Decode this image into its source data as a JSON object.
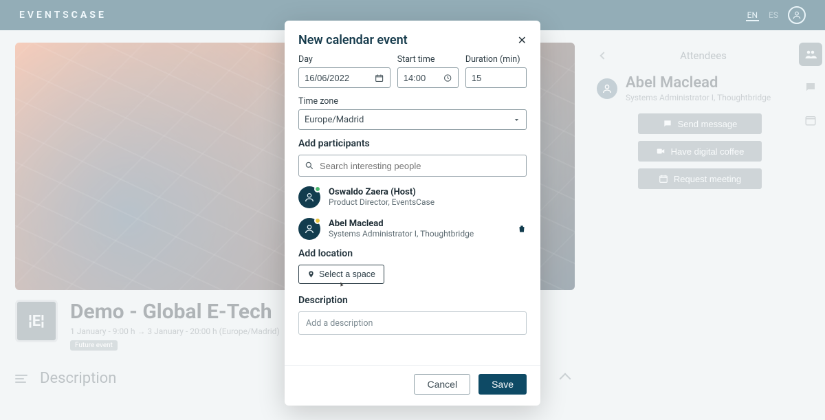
{
  "header": {
    "brand_prefix": "EVENTS",
    "brand_suffix": "CASE",
    "lang_en": "EN",
    "lang_es": "ES"
  },
  "event": {
    "title": "Demo - Global E-Tech",
    "schedule": "1 January - 9:00 h → 3 January - 20:00 h (Europe/Madrid)",
    "badge": "Future event",
    "thumb": "¦E¦",
    "section_title": "Description"
  },
  "sidebar": {
    "header": "Attendees",
    "name": "Abel Maclead",
    "role": "Systems Administrator I, Thoughtbridge",
    "actions": {
      "send_message": "Send message",
      "digital_coffee": "Have digital coffee",
      "request_meeting": "Request meeting"
    }
  },
  "modal": {
    "title": "New calendar event",
    "day_label": "Day",
    "day_value": "16/06/2022",
    "start_label": "Start time",
    "start_value": "14:00",
    "duration_label": "Duration (min)",
    "duration_value": "15",
    "tz_label": "Time zone",
    "tz_value": "Europe/Madrid",
    "participants_label": "Add participants",
    "search_placeholder": "Search interesting people",
    "participants": [
      {
        "name": "Oswaldo Zaera (Host)",
        "role": "Product Director, EventsCase",
        "status": "green",
        "removable": false
      },
      {
        "name": "Abel Maclead",
        "role": "Systems Administrator I, Thoughtbridge",
        "status": "yellow",
        "removable": true
      }
    ],
    "location_label": "Add location",
    "select_space": "Select a space",
    "description_label": "Description",
    "description_placeholder": "Add a description",
    "cancel": "Cancel",
    "save": "Save"
  }
}
